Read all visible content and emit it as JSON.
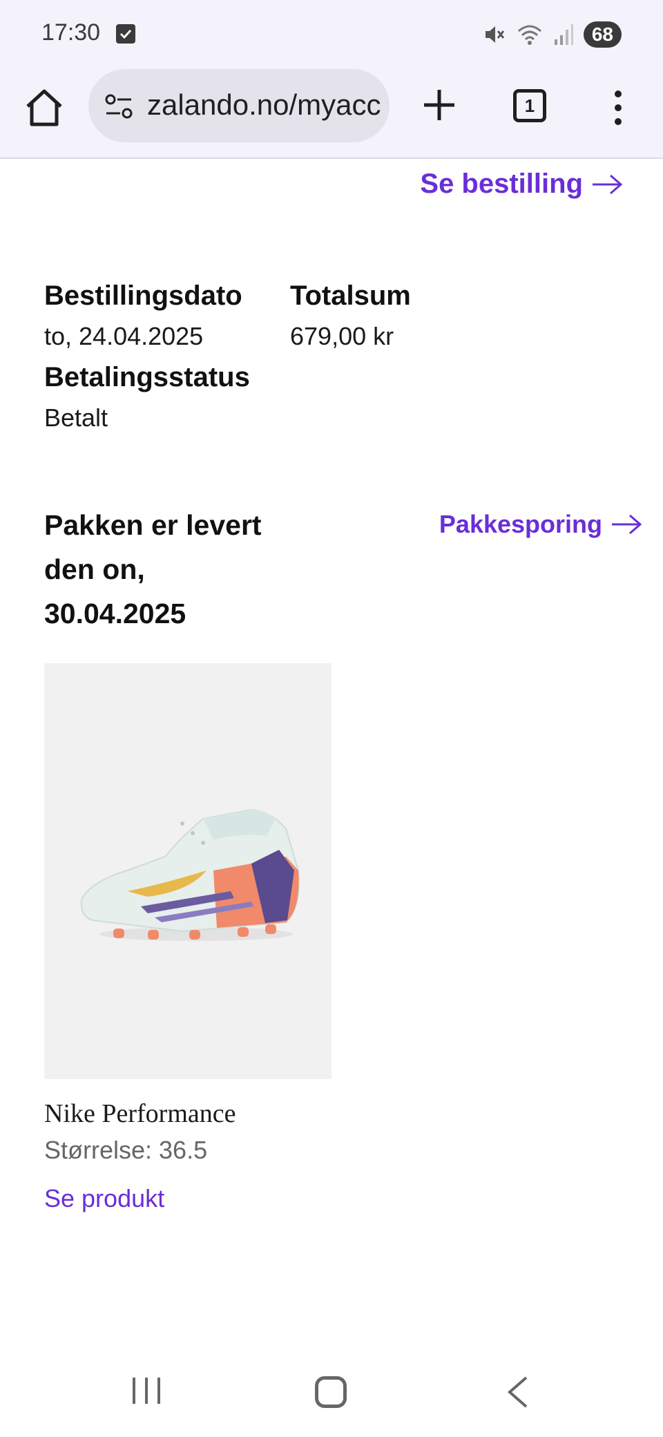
{
  "status_bar": {
    "time": "17:30",
    "battery": "68"
  },
  "browser": {
    "url": "zalando.no/myaccount",
    "tab_count": "1"
  },
  "order": {
    "see_order_label": "Se bestilling",
    "order_date_label": "Bestillingsdato",
    "order_date_value": "to, 24.04.2025",
    "total_label": "Totalsum",
    "total_value": "679,00 kr",
    "payment_status_label": "Betalingsstatus",
    "payment_status_value": "Betalt"
  },
  "delivery": {
    "status_text": "Pakken er levert den on, 30.04.2025",
    "tracking_label": "Pakkesporing"
  },
  "product": {
    "brand": "Nike Performance",
    "size": "Størrelse: 36.5",
    "see_product_label": "Se produkt"
  },
  "colors": {
    "accent": "#6a2ed8",
    "chrome_bg": "#f4f2fa",
    "product_bg": "#f1f1f1"
  }
}
